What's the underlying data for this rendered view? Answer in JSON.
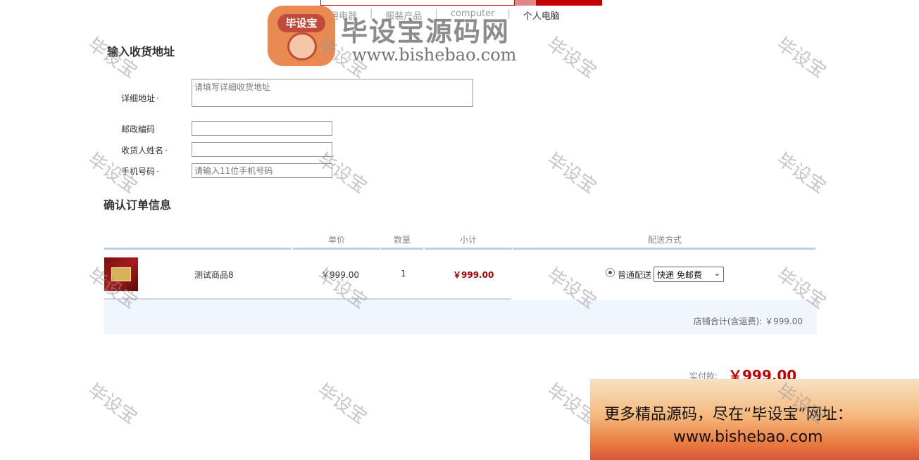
{
  "nav": {
    "items": [
      "家用电器",
      "|",
      "服装产品",
      "|",
      "computer",
      "|",
      "个人电脑"
    ]
  },
  "logo": {
    "badge_text": "毕设宝",
    "title": "毕设宝源码网",
    "url": "www.bishebao.com"
  },
  "address_section": {
    "title": "输入收货地址",
    "detail_label": "详细地址",
    "detail_placeholder": "请填写详细收货地址",
    "postcode_label": "邮政编码",
    "postcode_value": "",
    "receiver_label": "收货人姓名",
    "receiver_value": "",
    "phone_label": "手机号码",
    "phone_placeholder": "请输入11位手机号码",
    "required_mark": "·"
  },
  "order_section": {
    "title": "确认订单信息",
    "columns": {
      "unit_price": "单价",
      "quantity": "数量",
      "subtotal": "小计",
      "shipping": "配送方式"
    },
    "items": [
      {
        "name": "测试商品8",
        "unit_price": "￥999.00",
        "quantity": "1",
        "subtotal": "￥999.00",
        "shipping_option": "普通配送",
        "shipping_select": "快递 免邮费"
      }
    ],
    "store_total": "店铺合计(含运费): ￥999.00",
    "pay_label": "实付款:",
    "pay_value": "￥999.00"
  },
  "watermark": "毕设宝",
  "promo": {
    "line1": "更多精品源码，尽在“毕设宝”网址：",
    "line2": "www.bishebao.com"
  },
  "colors": {
    "accent_red": "#c40000",
    "table_line": "#b8cfee",
    "summary_bg": "#f1f6fe"
  }
}
